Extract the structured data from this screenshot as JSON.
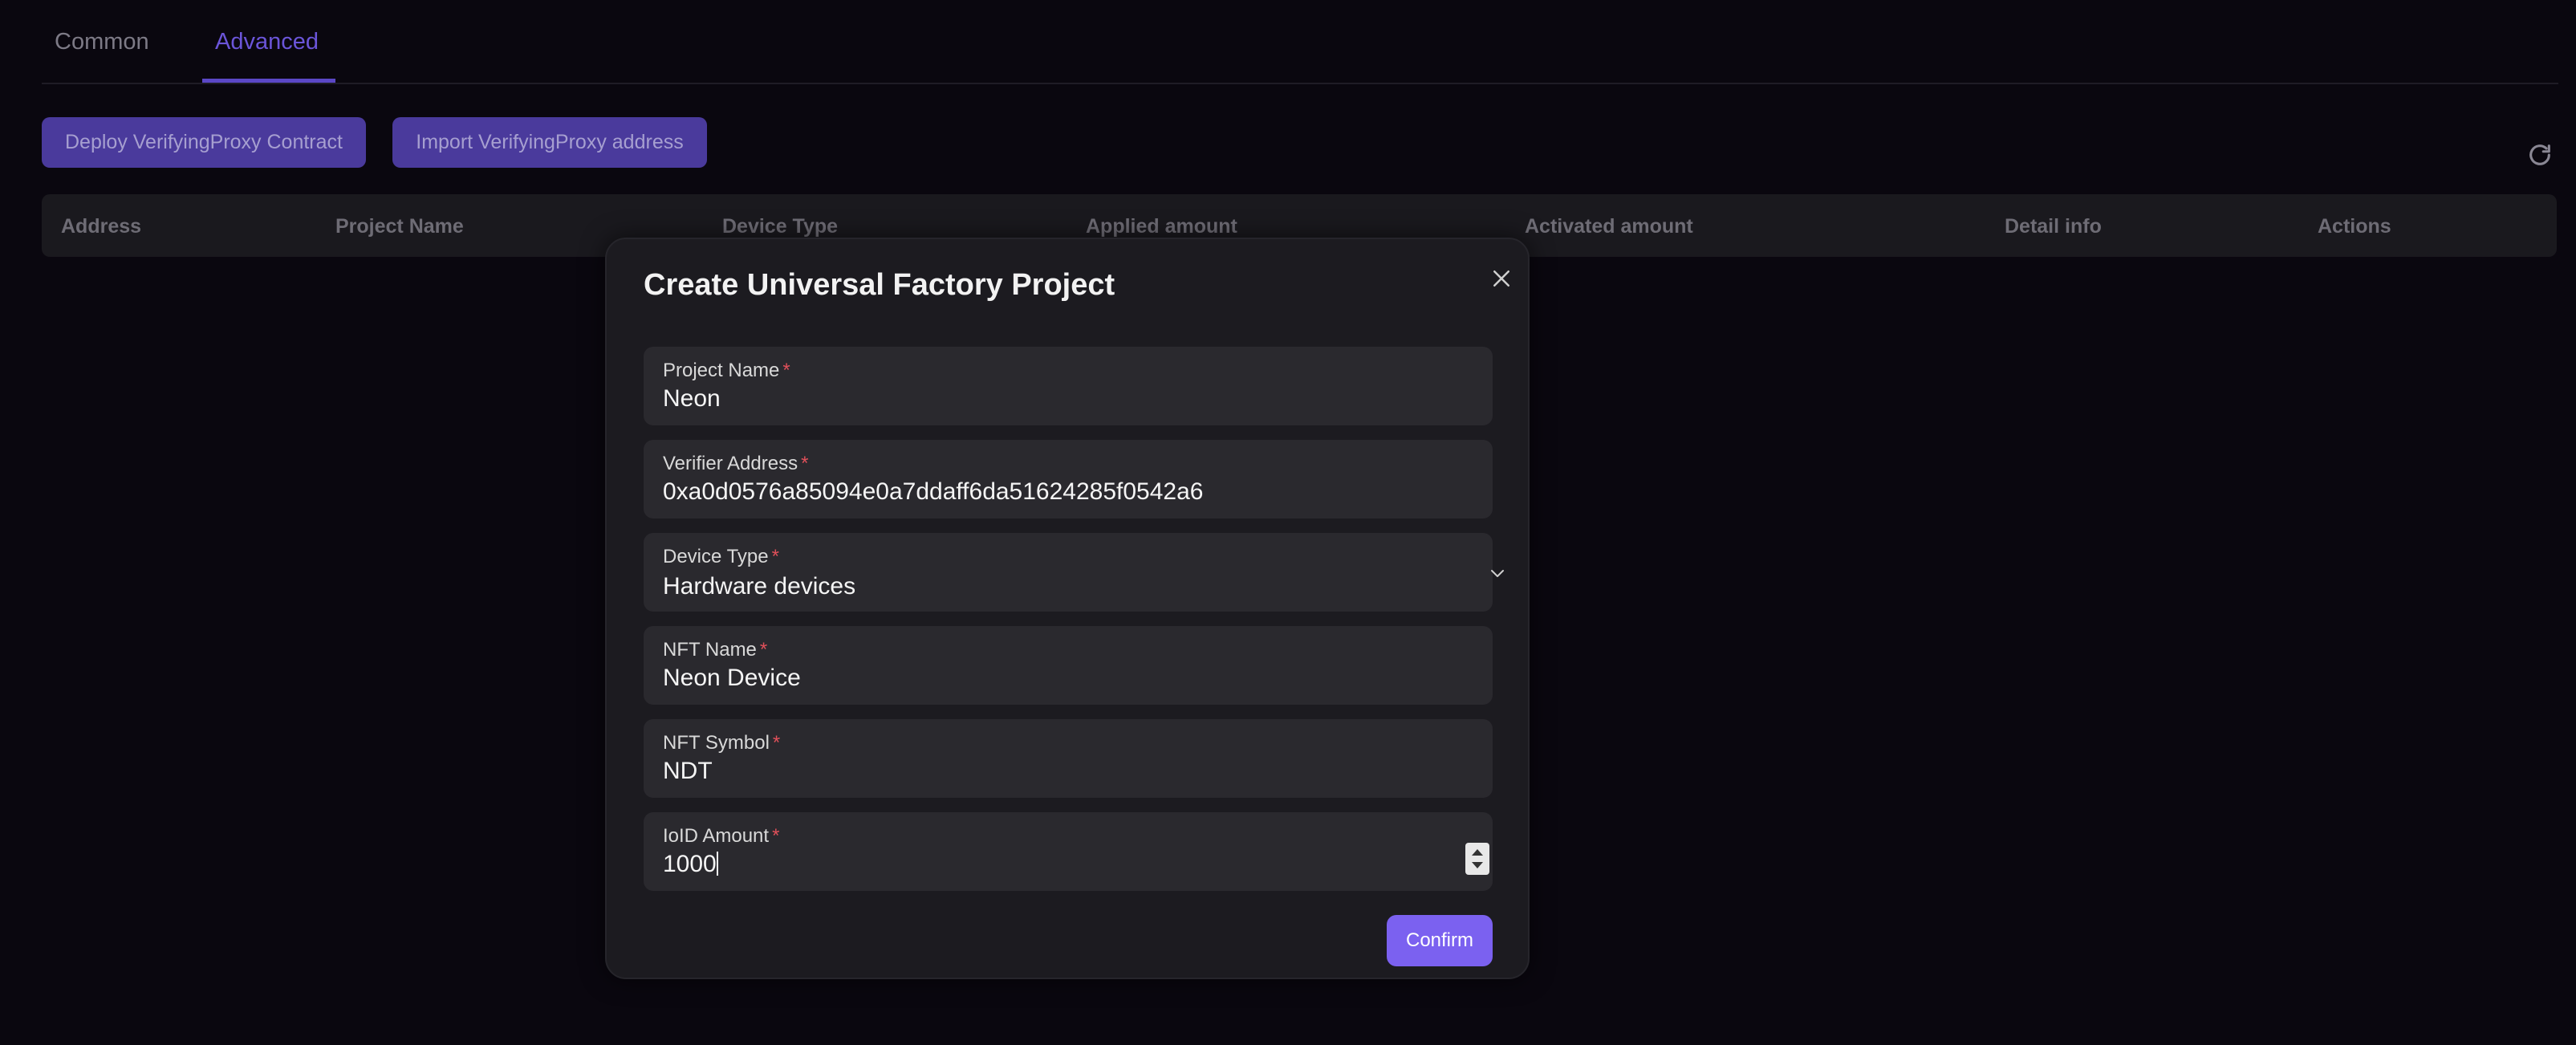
{
  "tabs": [
    {
      "label": "Common",
      "active": false
    },
    {
      "label": "Advanced",
      "active": true
    }
  ],
  "toolbar": {
    "deploy_label": "Deploy VerifyingProxy Contract",
    "import_label": "Import VerifyingProxy address",
    "refresh_icon": "refresh-icon"
  },
  "table": {
    "columns": [
      "Address",
      "Project Name",
      "Device Type",
      "Applied amount",
      "Activated amount",
      "Detail info",
      "Actions"
    ]
  },
  "modal": {
    "title": "Create Universal Factory Project",
    "close_icon": "close-icon",
    "fields": [
      {
        "label": "Project Name",
        "value": "Neon",
        "required": true
      },
      {
        "label": "Verifier Address",
        "value": "0xa0d0576a85094e0a7ddaff6da51624285f0542a6",
        "required": true
      },
      {
        "label": "Device Type",
        "value": "Hardware devices",
        "required": true,
        "type": "select"
      },
      {
        "label": "NFT Name",
        "value": "Neon Device",
        "required": true
      },
      {
        "label": "NFT Symbol",
        "value": "NDT",
        "required": true
      },
      {
        "label": "IoID Amount",
        "value": "1000",
        "required": true,
        "type": "number"
      }
    ],
    "required_mark": "*",
    "confirm_label": "Confirm"
  },
  "colors": {
    "background": "#0a070f",
    "accent": "#7b61f0",
    "active_tab": "#6b55d9",
    "required": "#e0505a"
  }
}
